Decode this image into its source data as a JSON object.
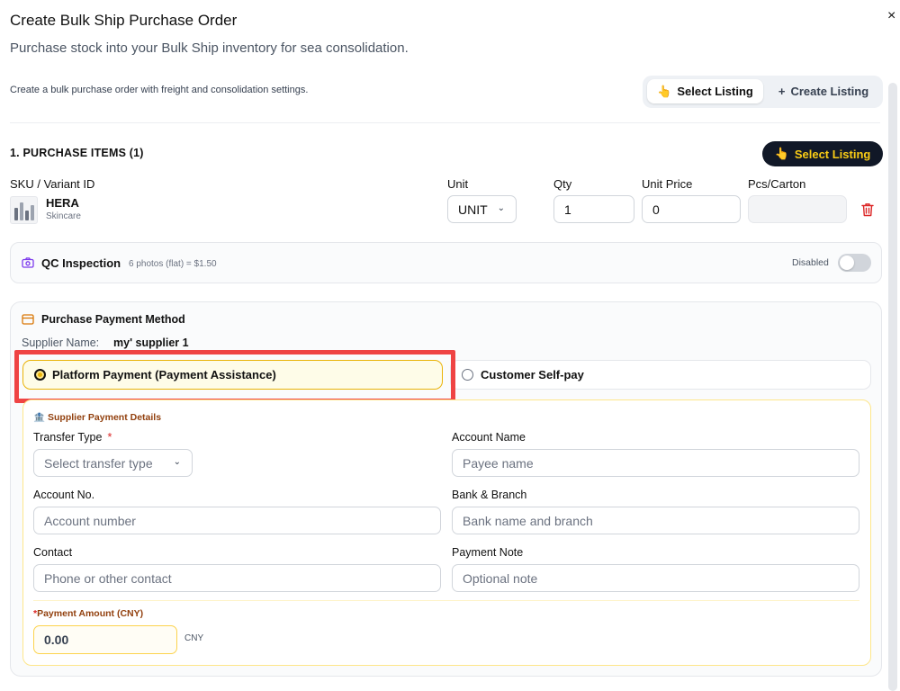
{
  "header": {
    "title": "Create Bulk Ship Purchase Order",
    "close": "×",
    "subtitle": "Purchase stock into your Bulk Ship inventory for sea consolidation.",
    "description": "Create a bulk purchase order with freight and consolidation settings."
  },
  "mode_switch": {
    "select_label": "Select Listing",
    "select_icon": "👆",
    "create_label": "Create Listing",
    "create_icon": "+"
  },
  "items": {
    "section_title": "1. PURCHASE ITEMS (1)",
    "select_button": "Select Listing",
    "select_button_icon": "👆",
    "columns": {
      "sku": "SKU / Variant ID",
      "unit": "Unit",
      "qty": "Qty",
      "unit_price": "Unit Price",
      "pcs_carton": "Pcs/Carton"
    },
    "row": {
      "name": "HERA",
      "category": "Skincare",
      "unit": "UNIT",
      "qty": "1",
      "unit_price": "0",
      "pcs_carton": ""
    }
  },
  "qc": {
    "title": "QC Inspection",
    "note": "6 photos (flat) = $1.50",
    "status": "Disabled",
    "enabled": false
  },
  "payment": {
    "title": "Purchase Payment Method",
    "supplier_label": "Supplier Name:",
    "supplier_name": "my' supplier 1",
    "option_platform": "Platform Payment (Payment Assistance)",
    "option_self": "Customer Self-pay",
    "selected": "platform",
    "details": {
      "title": "Supplier Payment Details",
      "transfer_type_label": "Transfer Type",
      "required_mark": "*",
      "transfer_type_placeholder": "Select transfer type",
      "account_name_label": "Account Name",
      "account_name_placeholder": "Payee name",
      "account_no_label": "Account No.",
      "account_no_placeholder": "Account number",
      "bank_label": "Bank & Branch",
      "bank_placeholder": "Bank name and branch",
      "contact_label": "Contact",
      "contact_placeholder": "Phone or other contact",
      "note_label": "Payment Note",
      "note_placeholder": "Optional note",
      "amount_label": "Payment Amount (CNY)",
      "amount_value": "0.00",
      "amount_unit": "CNY"
    }
  },
  "colors": {
    "accent_yellow": "#eab308",
    "dark_button": "#111827",
    "highlight_red": "#ef4444",
    "delete_red": "#dc2626"
  }
}
